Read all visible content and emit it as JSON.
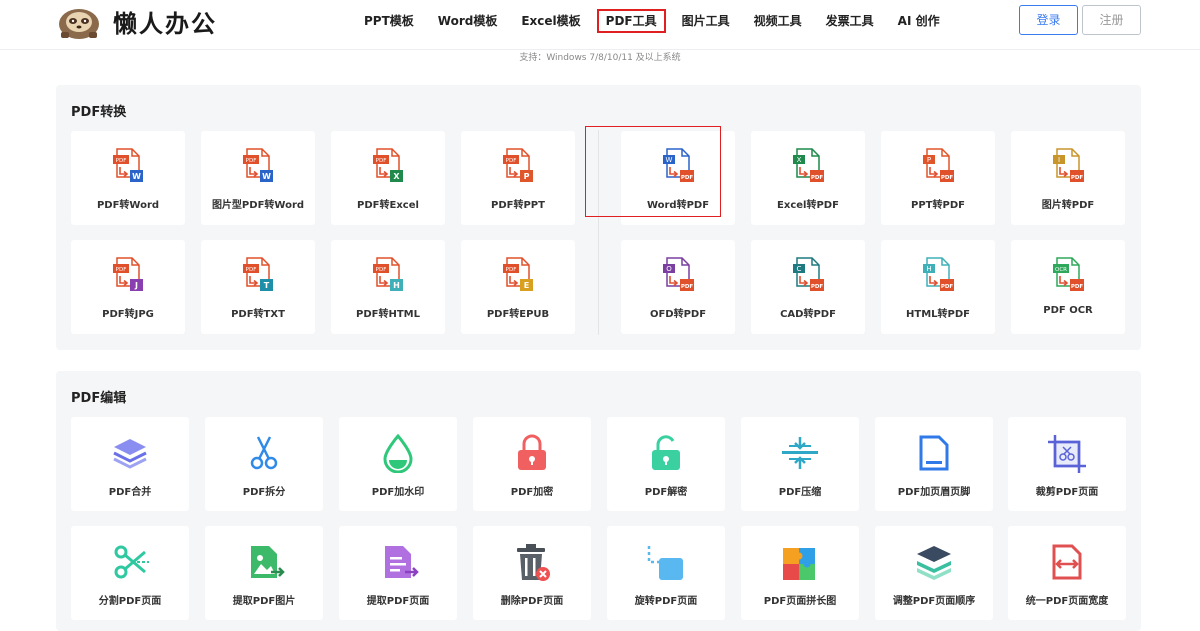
{
  "header": {
    "logo_text": "懒人办公",
    "nav": [
      "PPT模板",
      "Word模板",
      "Excel模板",
      "PDF工具",
      "图片工具",
      "视频工具",
      "发票工具",
      "AI 创作"
    ],
    "active_nav": "PDF工具",
    "login_label": "登录",
    "register_label": "注册"
  },
  "support_text": "支持：Windows 7/8/10/11 及以上系统",
  "convert": {
    "title": "PDF转换",
    "items": [
      {
        "label": "PDF转Word",
        "badge": "W",
        "color": "#2b64c8"
      },
      {
        "label": "图片型PDF转Word",
        "badge": "W",
        "color": "#2b64c8"
      },
      {
        "label": "PDF转Excel",
        "badge": "X",
        "color": "#1f8a4c"
      },
      {
        "label": "PDF转PPT",
        "badge": "P",
        "color": "#e0562b"
      },
      {
        "label": "Word转PDF",
        "badge": "W",
        "color": "#2b64c8"
      },
      {
        "label": "Excel转PDF",
        "badge": "X",
        "color": "#1f8a4c"
      },
      {
        "label": "PPT转PDF",
        "badge": "P",
        "color": "#e0562b"
      },
      {
        "label": "图片转PDF",
        "badge": "I",
        "color": "#c8952b"
      },
      {
        "label": "PDF转JPG",
        "badge": "J",
        "color": "#8a3fb0"
      },
      {
        "label": "PDF转TXT",
        "badge": "T",
        "color": "#1e8fa8"
      },
      {
        "label": "PDF转HTML",
        "badge": "H",
        "color": "#3fb0b8"
      },
      {
        "label": "PDF转EPUB",
        "badge": "E",
        "color": "#d8a01e"
      },
      {
        "label": "OFD转PDF",
        "badge": "O",
        "color": "#7a3fa0"
      },
      {
        "label": "CAD转PDF",
        "badge": "C",
        "color": "#1f7a80"
      },
      {
        "label": "HTML转PDF",
        "badge": "H",
        "color": "#3fb0b8"
      },
      {
        "label": "PDF OCR",
        "badge": "OCR",
        "color": "#2ea85a"
      }
    ]
  },
  "edit": {
    "title": "PDF编辑",
    "items": [
      {
        "label": "PDF合并",
        "icon": "layers-icon"
      },
      {
        "label": "PDF拆分",
        "icon": "scissors-icon"
      },
      {
        "label": "PDF加水印",
        "icon": "water-drop-icon"
      },
      {
        "label": "PDF加密",
        "icon": "lock-icon"
      },
      {
        "label": "PDF解密",
        "icon": "unlock-icon"
      },
      {
        "label": "PDF压缩",
        "icon": "compress-icon"
      },
      {
        "label": "PDF加页眉页脚",
        "icon": "header-footer-icon"
      },
      {
        "label": "裁剪PDF页面",
        "icon": "crop-icon"
      },
      {
        "label": "分割PDF页面",
        "icon": "split-scissors-icon"
      },
      {
        "label": "提取PDF图片",
        "icon": "extract-image-icon"
      },
      {
        "label": "提取PDF页面",
        "icon": "extract-page-icon"
      },
      {
        "label": "删除PDF页面",
        "icon": "trash-icon"
      },
      {
        "label": "旋转PDF页面",
        "icon": "rotate-icon"
      },
      {
        "label": "PDF页面拼长图",
        "icon": "puzzle-icon"
      },
      {
        "label": "调整PDF页面顺序",
        "icon": "reorder-icon"
      },
      {
        "label": "统一PDF页面宽度",
        "icon": "unify-width-icon"
      }
    ]
  }
}
